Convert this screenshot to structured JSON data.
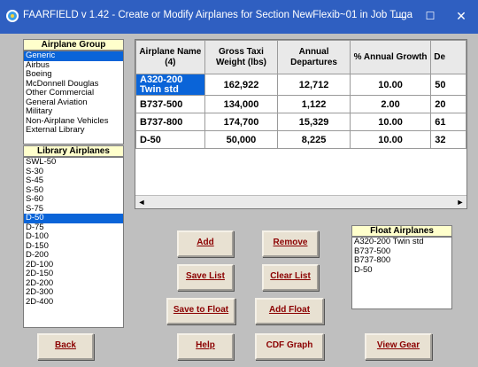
{
  "window": {
    "title": "FAARFIELD v 1.42 - Create or Modify Airplanes for Section NewFlexib~01 in Job Tugas...",
    "minimize_glyph": "—",
    "maximize_glyph": "☐",
    "close_glyph": "✕"
  },
  "airplane_group": {
    "label": "Airplane Group",
    "items": [
      "Generic",
      "Airbus",
      "Boeing",
      "McDonnell Douglas",
      "Other Commercial",
      "General Aviation",
      "Military",
      "Non-Airplane Vehicles",
      "External Library"
    ],
    "selected": "Generic"
  },
  "library_airplanes": {
    "label": "Library Airplanes",
    "items": [
      "SWL-50",
      "S-30",
      "S-45",
      "S-50",
      "S-60",
      "S-75",
      "D-50",
      "D-75",
      "D-100",
      "D-150",
      "D-200",
      "2D-100",
      "2D-150",
      "2D-200",
      "2D-300",
      "2D-400"
    ],
    "selected": "D-50"
  },
  "grid": {
    "headers": [
      "Airplane Name (4)",
      "Gross Taxi Weight (lbs)",
      "Annual Departures",
      "% Annual Growth",
      "De"
    ],
    "rows": [
      [
        "A320-200 Twin std",
        "162,922",
        "12,712",
        "10.00",
        "50"
      ],
      [
        "B737-500",
        "134,000",
        "1,122",
        "2.00",
        "20"
      ],
      [
        "B737-800",
        "174,700",
        "15,329",
        "10.00",
        "61"
      ],
      [
        "D-50",
        "50,000",
        "8,225",
        "10.00",
        "32"
      ]
    ],
    "scroll_left": "◄",
    "scroll_right": "►"
  },
  "float_airplanes": {
    "label": "Float Airplanes",
    "items": [
      "A320-200 Twin std",
      "B737-500",
      "B737-800",
      "D-50"
    ]
  },
  "buttons": {
    "add": "Add",
    "remove": "Remove",
    "save_list": "Save List",
    "clear_list": "Clear List",
    "save_to_float": "Save to Float",
    "add_float": "Add Float",
    "back": "Back",
    "help": "Help",
    "cdf_graph": "CDF Graph",
    "view_gear": "View Gear"
  },
  "colors": {
    "titlebar": "#2f5fc1",
    "selection": "#0a64d8",
    "label_bg": "#ffffcc",
    "button_text": "#8b0000"
  }
}
